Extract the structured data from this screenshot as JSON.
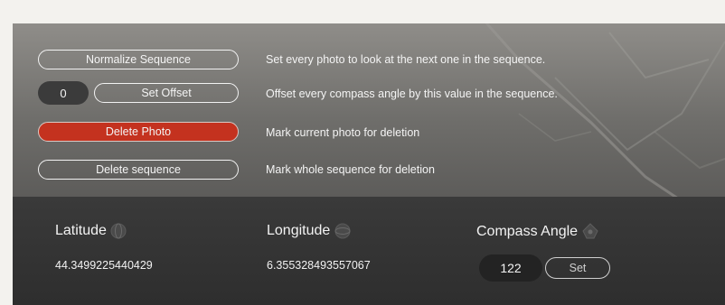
{
  "actions": {
    "normalize": {
      "label": "Normalize Sequence",
      "description": "Set every photo to look at the next one in the sequence."
    },
    "offset": {
      "value": "0",
      "label": "Set Offset",
      "description": "Offset every compass angle by this value in the sequence."
    },
    "delete_photo": {
      "label": "Delete Photo",
      "description": "Mark current photo for deletion"
    },
    "delete_sequence": {
      "label": "Delete sequence",
      "description": "Mark whole sequence for deletion"
    }
  },
  "fields": {
    "latitude": {
      "label": "Latitude",
      "value": "44.3499225440429",
      "icon": "latitude-icon"
    },
    "longitude": {
      "label": "Longitude",
      "value": "6.355328493557067",
      "icon": "longitude-icon"
    },
    "compass": {
      "label": "Compass Angle",
      "value": "122",
      "set_label": "Set",
      "icon": "compass-icon"
    }
  },
  "colors": {
    "danger": "#c4321f",
    "panel_dark": "#2e2e2e",
    "panel_gray": "#7a7976"
  }
}
